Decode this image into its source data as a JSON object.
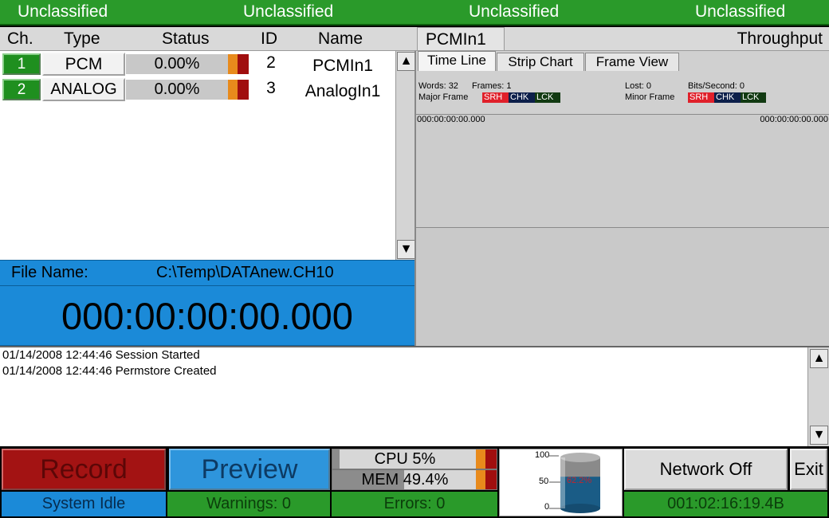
{
  "banner": {
    "labels": [
      "Unclassified",
      "Unclassified",
      "Unclassified",
      "Unclassified"
    ],
    "color": "#2a9a2a"
  },
  "channels": {
    "headers": {
      "ch": "Ch.",
      "type": "Type",
      "status": "Status",
      "id": "ID",
      "name": "Name"
    },
    "rows": [
      {
        "ch": "1",
        "type": "PCM",
        "status": "0.00%",
        "id": "2",
        "name": "PCMIn1"
      },
      {
        "ch": "2",
        "type": "ANALOG",
        "status": "0.00%",
        "id": "3",
        "name": "AnalogIn1"
      }
    ]
  },
  "file": {
    "label": "File Name:",
    "path": "C:\\Temp\\DATAnew.CH10"
  },
  "timer": "000:00:00:00.000",
  "right_panel": {
    "channel_name": "PCMIn1",
    "metric": "Throughput",
    "tabs": [
      "Time Line",
      "Strip Chart",
      "Frame View"
    ],
    "active_tab": "Time Line",
    "words": "Words: 32",
    "frames": "Frames: 1",
    "lost": "Lost: 0",
    "bits_per_second": "Bits/Second: 0",
    "major_frame_label": "Major Frame",
    "minor_frame_label": "Minor Frame",
    "flags": [
      "SRH",
      "CHK",
      "LCK"
    ],
    "timeline_start": "000:00:00:00.000",
    "timeline_end": "000:00:00:00.000"
  },
  "log": [
    "01/14/2008 12:44:46 Session Started",
    "01/14/2008 12:44:46 Permstore Created"
  ],
  "controls": {
    "record": "Record",
    "preview": "Preview",
    "cpu_label": "CPU 5%",
    "cpu_value": 5,
    "mem_label": "MEM 49.4%",
    "mem_value": 49.4,
    "disk_scale": [
      "100",
      "50",
      "0"
    ],
    "disk_fill_label": "62.2%",
    "disk_fill": 62.2,
    "network": "Network Off",
    "exit": "Exit"
  },
  "status": {
    "state": "System Idle",
    "warnings": "Warnings: 0",
    "errors": "Errors: 0",
    "elapsed": "001:02:16:19.4B"
  },
  "colors": {
    "green": "#2a9a2a",
    "blue": "#1b8ad8",
    "red": "#a31313",
    "orange": "#e88a1c"
  }
}
